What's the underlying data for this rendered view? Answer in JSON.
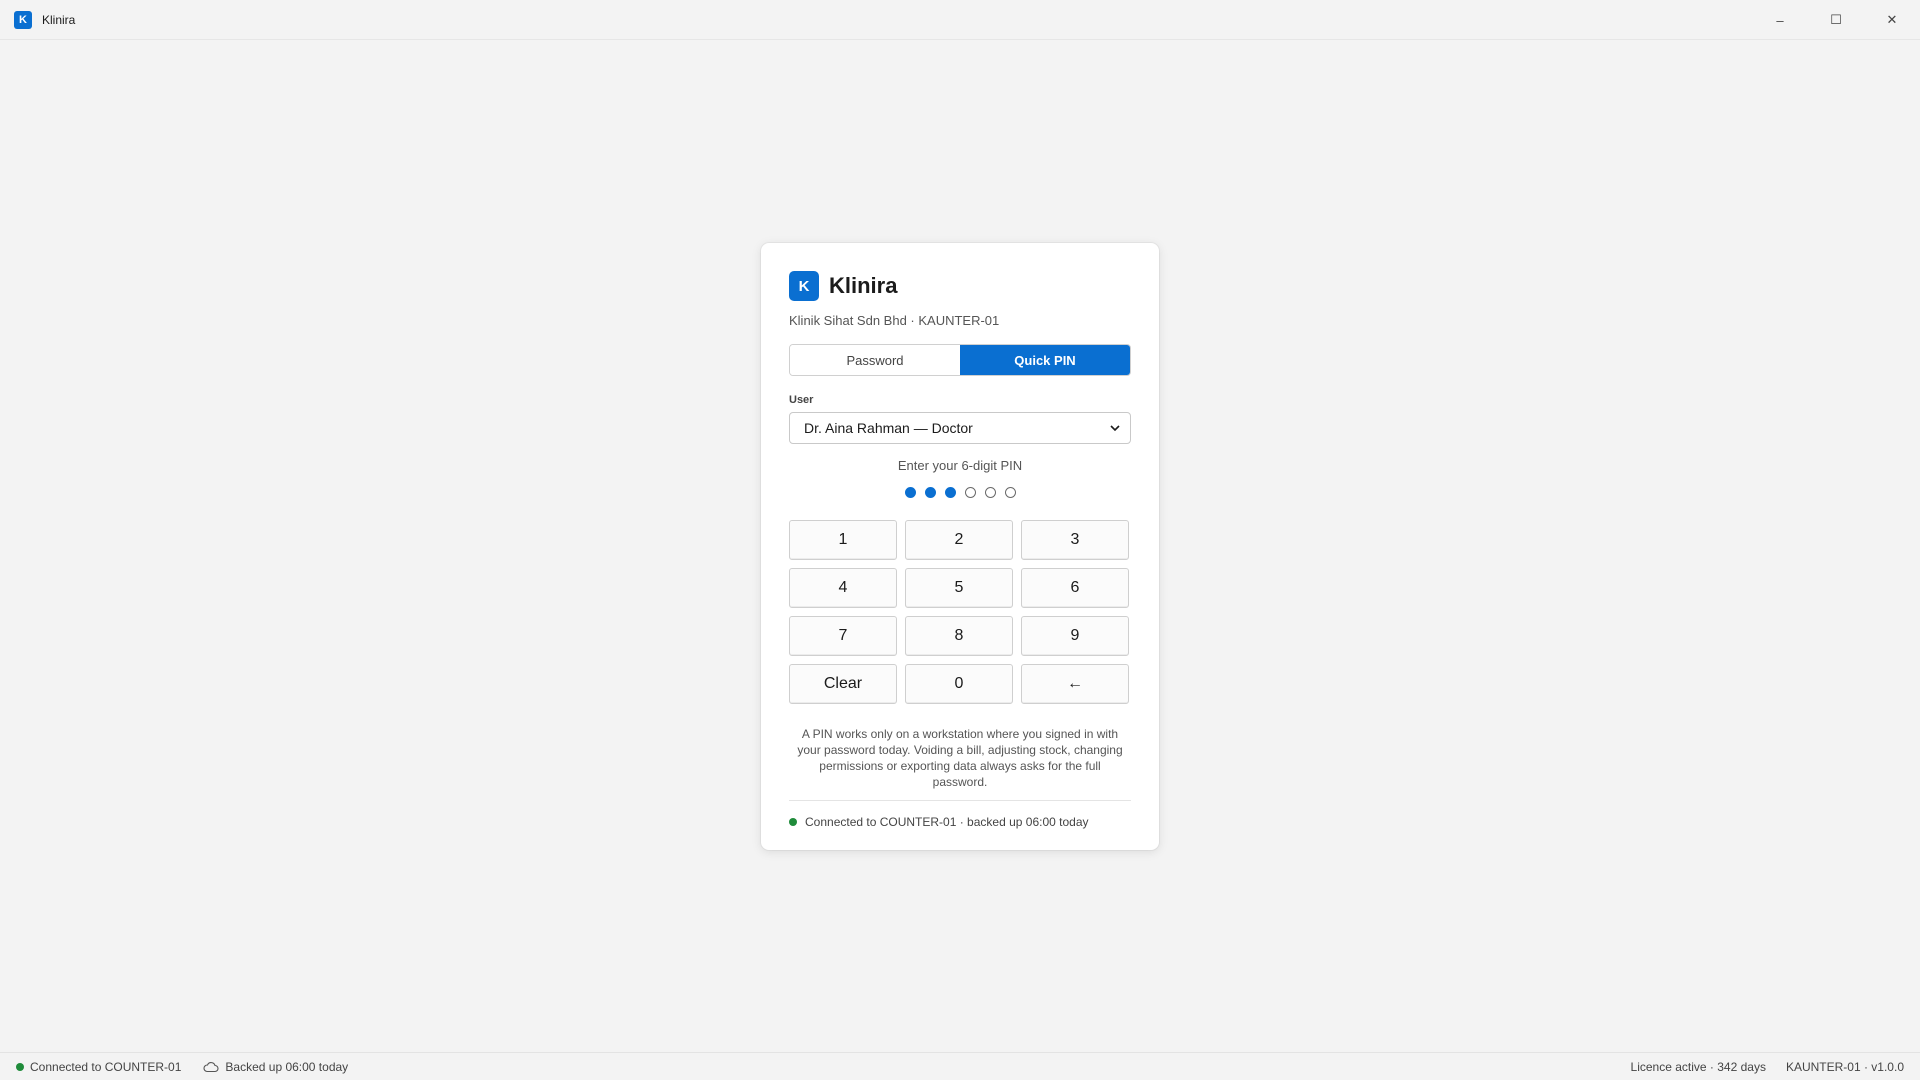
{
  "window": {
    "icon_letter": "K",
    "title": "Klinira",
    "controls": {
      "minimize": "–",
      "maximize": "☐",
      "close": "✕"
    }
  },
  "card": {
    "brand_letter": "K",
    "brand_name": "Klinira",
    "subtitle": "Klinik Sihat Sdn Bhd · KAUNTER-01",
    "tabs": [
      {
        "label": "Password",
        "active": false
      },
      {
        "label": "Quick PIN",
        "active": true
      }
    ],
    "user_label": "User",
    "user_selected": "Dr. Aina Rahman — Doctor",
    "pin_prompt": "Enter your 6-digit PIN",
    "pin_length": 6,
    "pin_entered": 3,
    "keys": [
      "1",
      "2",
      "3",
      "4",
      "5",
      "6",
      "7",
      "8",
      "9",
      "Clear",
      "0",
      "←"
    ],
    "note": "A PIN works only on a workstation where you signed in with your password today. Voiding a bill, adjusting stock, changing permissions or exporting data always asks for the full password.",
    "connection": "Connected to COUNTER-01 · backed up 06:00 today"
  },
  "statusbar": {
    "connected": "Connected to COUNTER-01",
    "backup": "Backed up 06:00 today",
    "licence": "Licence active · 342 days",
    "version": "KAUNTER-01 · v1.0.0"
  },
  "colors": {
    "accent": "#0a6fd1",
    "status_ok": "#1f8b3a"
  }
}
